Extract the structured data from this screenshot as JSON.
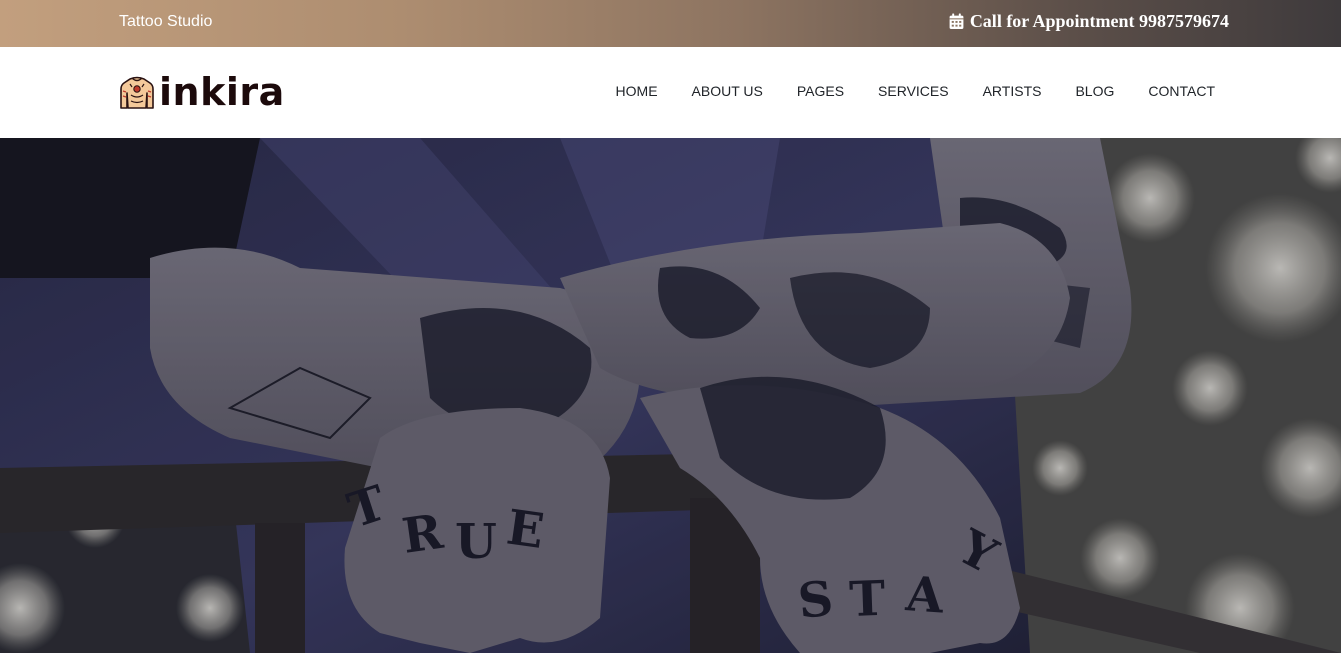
{
  "topbar": {
    "studio_label": "Tattoo Studio",
    "appointment_text": "Call for Appointment 9987579674",
    "icon": "calendar-icon"
  },
  "brand": {
    "name": "inkira",
    "logo_icon": "tattooed-torso-icon"
  },
  "nav": {
    "items": [
      "HOME",
      "ABOUT US",
      "PAGES",
      "SERVICES",
      "ARTISTS",
      "BLOG",
      "CONTACT"
    ]
  },
  "hero": {
    "image": "tattooed-arms-photo",
    "knuckle_tattoos": [
      "TRUE",
      "STAY"
    ]
  },
  "colors": {
    "topbar_start": "#c29f7e",
    "topbar_end": "#3e3a3c",
    "nav_text": "#1f2328",
    "brand_text": "#1c0a0b"
  }
}
